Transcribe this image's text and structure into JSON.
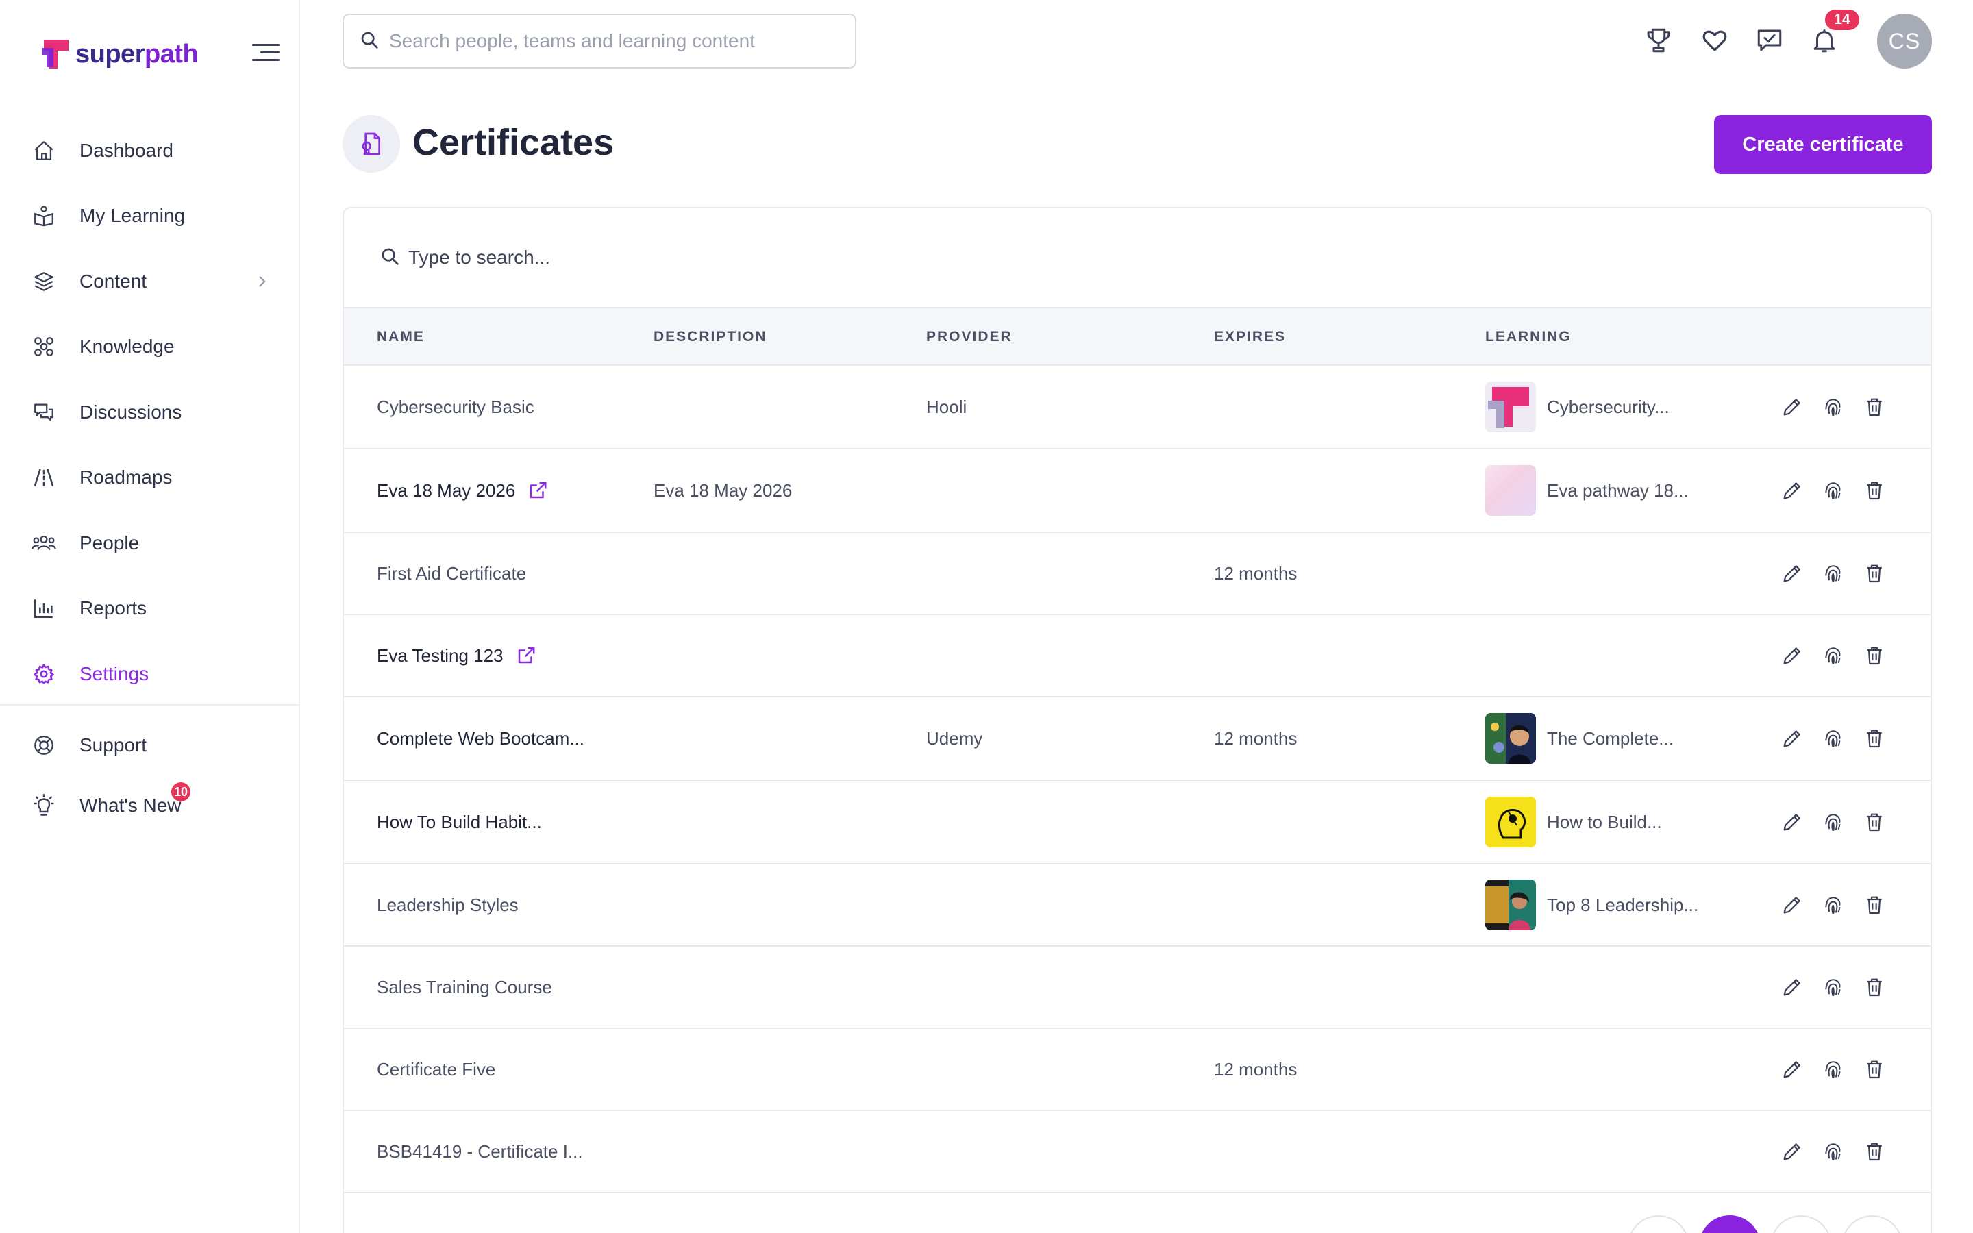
{
  "app": {
    "logo_prefix": "super",
    "logo_suffix": "path"
  },
  "sidebar": {
    "items": [
      {
        "label": "Dashboard",
        "icon": "home-icon"
      },
      {
        "label": "My Learning",
        "icon": "learning-icon"
      },
      {
        "label": "Content",
        "icon": "layers-icon"
      },
      {
        "label": "Knowledge",
        "icon": "knowledge-icon"
      },
      {
        "label": "Discussions",
        "icon": "discussions-icon"
      },
      {
        "label": "Roadmaps",
        "icon": "roadmaps-icon"
      },
      {
        "label": "People",
        "icon": "people-icon"
      },
      {
        "label": "Reports",
        "icon": "reports-icon"
      },
      {
        "label": "Settings",
        "icon": "settings-icon"
      }
    ],
    "bottom_items": [
      {
        "label": "Support",
        "icon": "support-icon"
      },
      {
        "label": "What's New",
        "icon": "lightbulb-icon",
        "badge": "10"
      }
    ],
    "active": "Settings"
  },
  "topbar": {
    "search_placeholder": "Search people, teams and learning content",
    "notifications_count": "14",
    "avatar_initials": "CS"
  },
  "page": {
    "title": "Certificates",
    "create_button": "Create certificate"
  },
  "table": {
    "search_placeholder": "Type to search...",
    "columns": [
      "NAME",
      "DESCRIPTION",
      "PROVIDER",
      "EXPIRES",
      "LEARNING"
    ],
    "rows": [
      {
        "name": "Cybersecurity Basic",
        "description": "",
        "provider": "Hooli",
        "expires": "",
        "learning": "Cybersecurity..."
      },
      {
        "name": "Eva 18 May 2026",
        "description": "Eva 18 May 2026",
        "provider": "",
        "expires": "",
        "learning": "Eva pathway 18..."
      },
      {
        "name": "First Aid Certificate",
        "description": "",
        "provider": "",
        "expires": "12 months",
        "learning": ""
      },
      {
        "name": "Eva Testing 123",
        "description": "",
        "provider": "",
        "expires": "",
        "learning": ""
      },
      {
        "name": "Complete Web Bootcam...",
        "description": "",
        "provider": "Udemy",
        "expires": "12 months",
        "learning": "The Complete..."
      },
      {
        "name": "How To Build Habit...",
        "description": "",
        "provider": "",
        "expires": "",
        "learning": "How to Build..."
      },
      {
        "name": "Leadership Styles",
        "description": "",
        "provider": "",
        "expires": "",
        "learning": "Top 8 Leadership..."
      },
      {
        "name": "Sales Training Course",
        "description": "",
        "provider": "",
        "expires": "",
        "learning": ""
      },
      {
        "name": "Certificate Five",
        "description": "",
        "provider": "",
        "expires": "12 months",
        "learning": ""
      },
      {
        "name": "BSB41419 - Certificate I...",
        "description": "",
        "provider": "",
        "expires": "",
        "learning": ""
      }
    ]
  },
  "colors": {
    "accent": "#8a23de",
    "badge": "#e8345a",
    "text": "#2d3142"
  }
}
